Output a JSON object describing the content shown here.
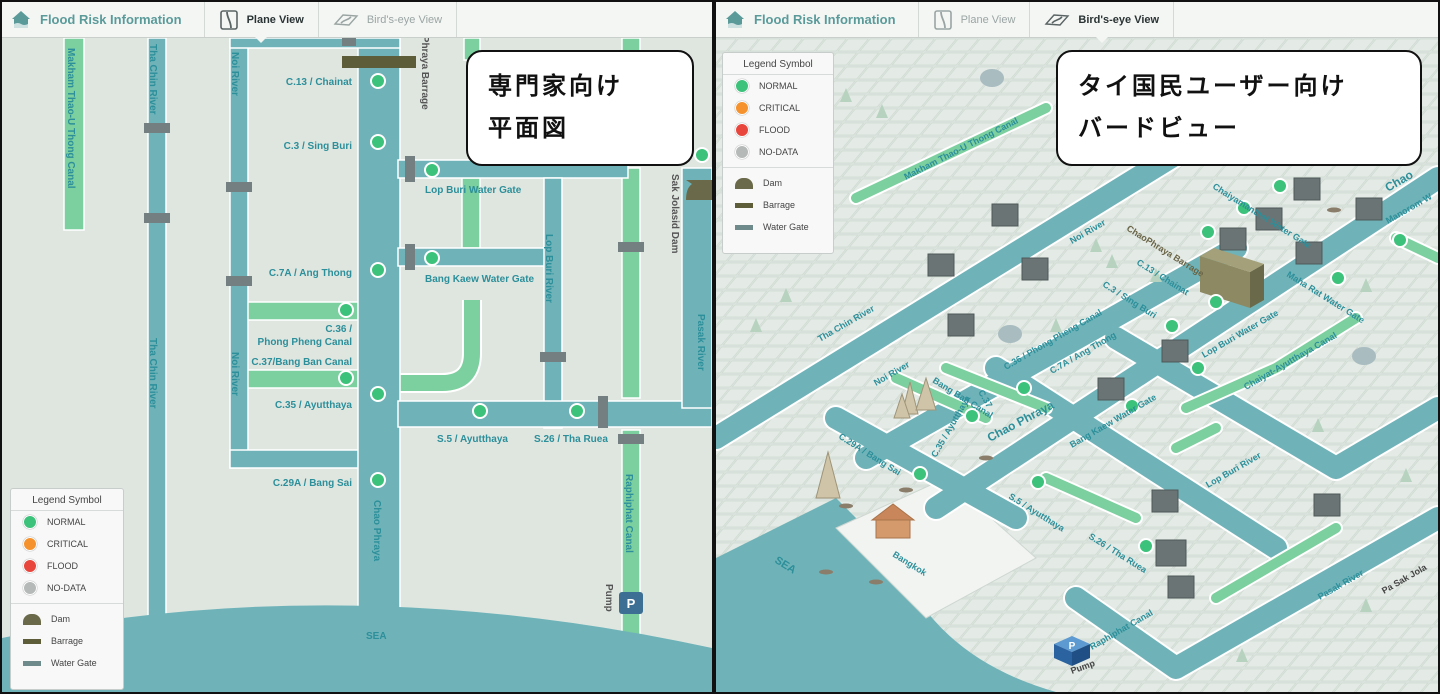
{
  "app": {
    "title": "Flood Risk Information",
    "tabs": [
      {
        "label": "Plane View",
        "active": true
      },
      {
        "label": "Bird's-eye View",
        "active": false
      }
    ]
  },
  "colors": {
    "land": "#dfe6e0",
    "river": "#6fb3b9",
    "canal": "#7ccf9f",
    "label": "#2c8f9a",
    "normal": "#3cc27a",
    "critical": "#f5922d",
    "flood": "#e8453c",
    "nodata": "#b5b9b8",
    "dam": "#6a6a4a",
    "barrage": "#5d5d3a",
    "gate": "#6f8a8a"
  },
  "legend": {
    "title": "Legend Symbol",
    "statuses": [
      {
        "label": "NORMAL",
        "icon": "status-normal-dot"
      },
      {
        "label": "CRITICAL",
        "icon": "status-critical-dot"
      },
      {
        "label": "FLOOD",
        "icon": "status-flood-dot"
      },
      {
        "label": "NO-DATA",
        "icon": "status-nodata-dot"
      }
    ],
    "structures": [
      {
        "label": "Dam",
        "icon": "dam-icon"
      },
      {
        "label": "Barrage",
        "icon": "barrage-icon"
      },
      {
        "label": "Water Gate",
        "icon": "water-gate-icon"
      }
    ]
  },
  "plane": {
    "callout": [
      "専門家向け",
      "平面図"
    ],
    "waterways": [
      "Makham Thao-U Thong Canal",
      "Tha Chin River",
      "Noi River",
      "Chao Phraya Barrage",
      "Lop Buri River",
      "Sak Jolasid Dam",
      "Pasak River",
      "Chao Phraya",
      "Raphiphat Canal",
      "Pump",
      "SEA"
    ],
    "stations": [
      "C.13 / Chainat",
      "C.3 / Sing Buri",
      "Lop Buri Water Gate",
      "C.7A / Ang Thong",
      "Bang Kaew Water Gate",
      "C.36 /",
      "Phong Pheng Canal",
      "C.37/Bang Ban Canal",
      "C.35 / Ayutthaya",
      "S.5 / Ayutthaya",
      "S.26 / Tha Ruea",
      "C.29A / Bang Sai"
    ],
    "pump_symbol": "P"
  },
  "birdseye": {
    "callout": [
      "タイ国民ユーザー向け",
      "バードビュー"
    ],
    "labels": [
      "Makham Thao-U Thong Canal",
      "Chaiyamanthat Water Gate",
      "Manorom W",
      "Chao",
      "Noi River",
      "ChaoPhraya Barrage",
      "C.13 / Chainat",
      "Maha Rat Water Gate",
      "C.3 / Sing Buri",
      "Tha Chin River",
      "C.36 / Phong Pheng Canal",
      "C.7A / Ang Thong",
      "Lop Buri Water Gate",
      "Chaiyat-Ayutthaya Canal",
      "Noi River",
      "Bang Ban Canal",
      "C.37",
      "C.35 / Ayutthaya",
      "Chao Phraya",
      "Bang Kaew Water Gate",
      "C.29A / Bang Sai",
      "Lop Buri River",
      "S.5 / Ayutthaya",
      "S.26 / Tha Ruea",
      "Bangkok",
      "SEA",
      "Pasak River",
      "Pa Sak Jola",
      "Raphiphat Canal",
      "Pump"
    ],
    "pump_symbol": "P"
  }
}
